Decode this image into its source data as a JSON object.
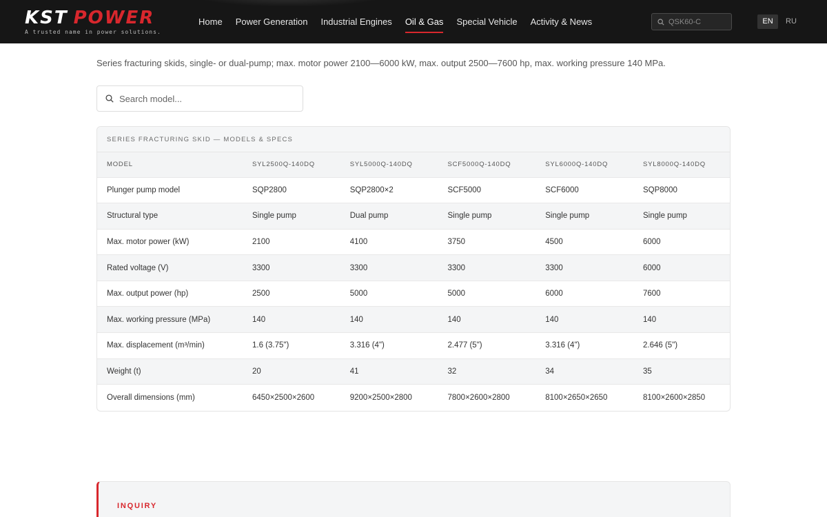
{
  "header": {
    "logo_kst": "KST",
    "logo_power": "POWER",
    "tagline": "A trusted name in power solutions.",
    "nav": [
      {
        "label": "Home"
      },
      {
        "label": "Power Generation"
      },
      {
        "label": "Industrial Engines"
      },
      {
        "label": "Oil & Gas",
        "active": true
      },
      {
        "label": "Special Vehicle"
      },
      {
        "label": "Activity & News"
      }
    ],
    "search_placeholder": "QSK60-C",
    "lang_en": "EN",
    "lang_ru": "RU",
    "accent_color": "#d8272d"
  },
  "intro": "Series fracturing skids, single- or dual-pump; max. motor power 2100—6000 kW, max. output 2500—7600 hp, max. working pressure 140 MPa.",
  "model_search_placeholder": "Search model...",
  "table": {
    "title": "SERIES FRACTURING SKID — MODELS & SPECS",
    "headers": [
      "MODEL",
      "SYL2500Q-140DQ",
      "SYL5000Q-140DQ",
      "SCF5000Q-140DQ",
      "SYL6000Q-140DQ",
      "SYL8000Q-140DQ"
    ],
    "rows": [
      [
        "Plunger pump model",
        "SQP2800",
        "SQP2800×2",
        "SCF5000",
        "SCF6000",
        "SQP8000"
      ],
      [
        "Structural type",
        "Single pump",
        "Dual pump",
        "Single pump",
        "Single pump",
        "Single pump"
      ],
      [
        "Max. motor power (kW)",
        "2100",
        "4100",
        "3750",
        "4500",
        "6000"
      ],
      [
        "Rated voltage (V)",
        "3300",
        "3300",
        "3300",
        "3300",
        "6000"
      ],
      [
        "Max. output power (hp)",
        "2500",
        "5000",
        "5000",
        "6000",
        "7600"
      ],
      [
        "Max. working pressure (MPa)",
        "140",
        "140",
        "140",
        "140",
        "140"
      ],
      [
        "Max. displacement (m³/min)",
        "1.6 (3.75\")",
        "3.316 (4\")",
        "2.477 (5\")",
        "3.316 (4\")",
        "2.646 (5\")"
      ],
      [
        "Weight (t)",
        "20",
        "41",
        "32",
        "34",
        "35"
      ],
      [
        "Overall dimensions (mm)",
        "6450×2500×2600",
        "9200×2500×2800",
        "7800×2600×2800",
        "8100×2650×2650",
        "8100×2600×2850"
      ]
    ]
  },
  "inquiry_label": "INQUIRY"
}
